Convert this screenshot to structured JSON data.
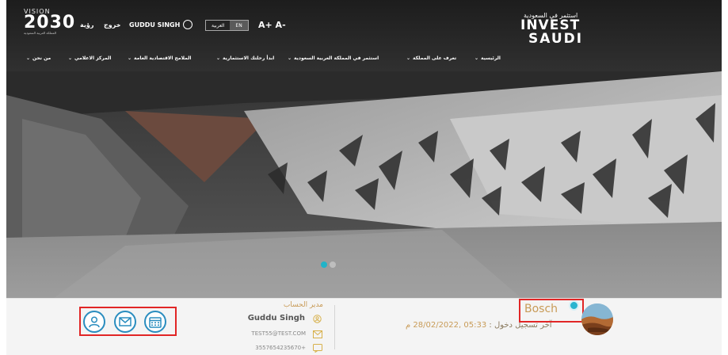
{
  "header": {
    "vision_small": "VISION",
    "vision_year": "2030",
    "vision_sub": "المملكة العربية السعودية",
    "logout": "خروج",
    "home_ar": "رؤية",
    "user_name": "GUDDU SINGH",
    "lang_ar": "العربية",
    "lang_en": "EN",
    "font_size": "A+ A-",
    "logo_ar": "استثمر في السعودية",
    "logo_invest": "INVEST",
    "logo_saudi": "SAUDI"
  },
  "nav": {
    "items": [
      "الرئيسية",
      "تعرف على المملكة",
      "استثمر في المملكة العربية السعودية",
      "ابدأ رحلتك الاستثمارية",
      "الملامح الاقتصادية العامة",
      "المركز الاعلامي",
      "من نحن"
    ]
  },
  "carousel": {
    "slides": 2,
    "active": 1
  },
  "account": {
    "manager_label": "مدير الحساب",
    "name": "Guddu Singh",
    "email": "TEST55@TEST.COM",
    "phone": "3557654235670+"
  },
  "company": {
    "name": "Bosch",
    "last_login_label": "آخر تسجيل دخول :",
    "last_login_value": "05:33 ,28/02/2022 م"
  },
  "colors": {
    "accent_gold": "#c89b57",
    "accent_blue": "#2a8dbf",
    "highlight_red": "#e12626",
    "carousel_active": "#21b3c8"
  },
  "icons": [
    "user-icon",
    "mail-icon",
    "calendar-icon"
  ]
}
